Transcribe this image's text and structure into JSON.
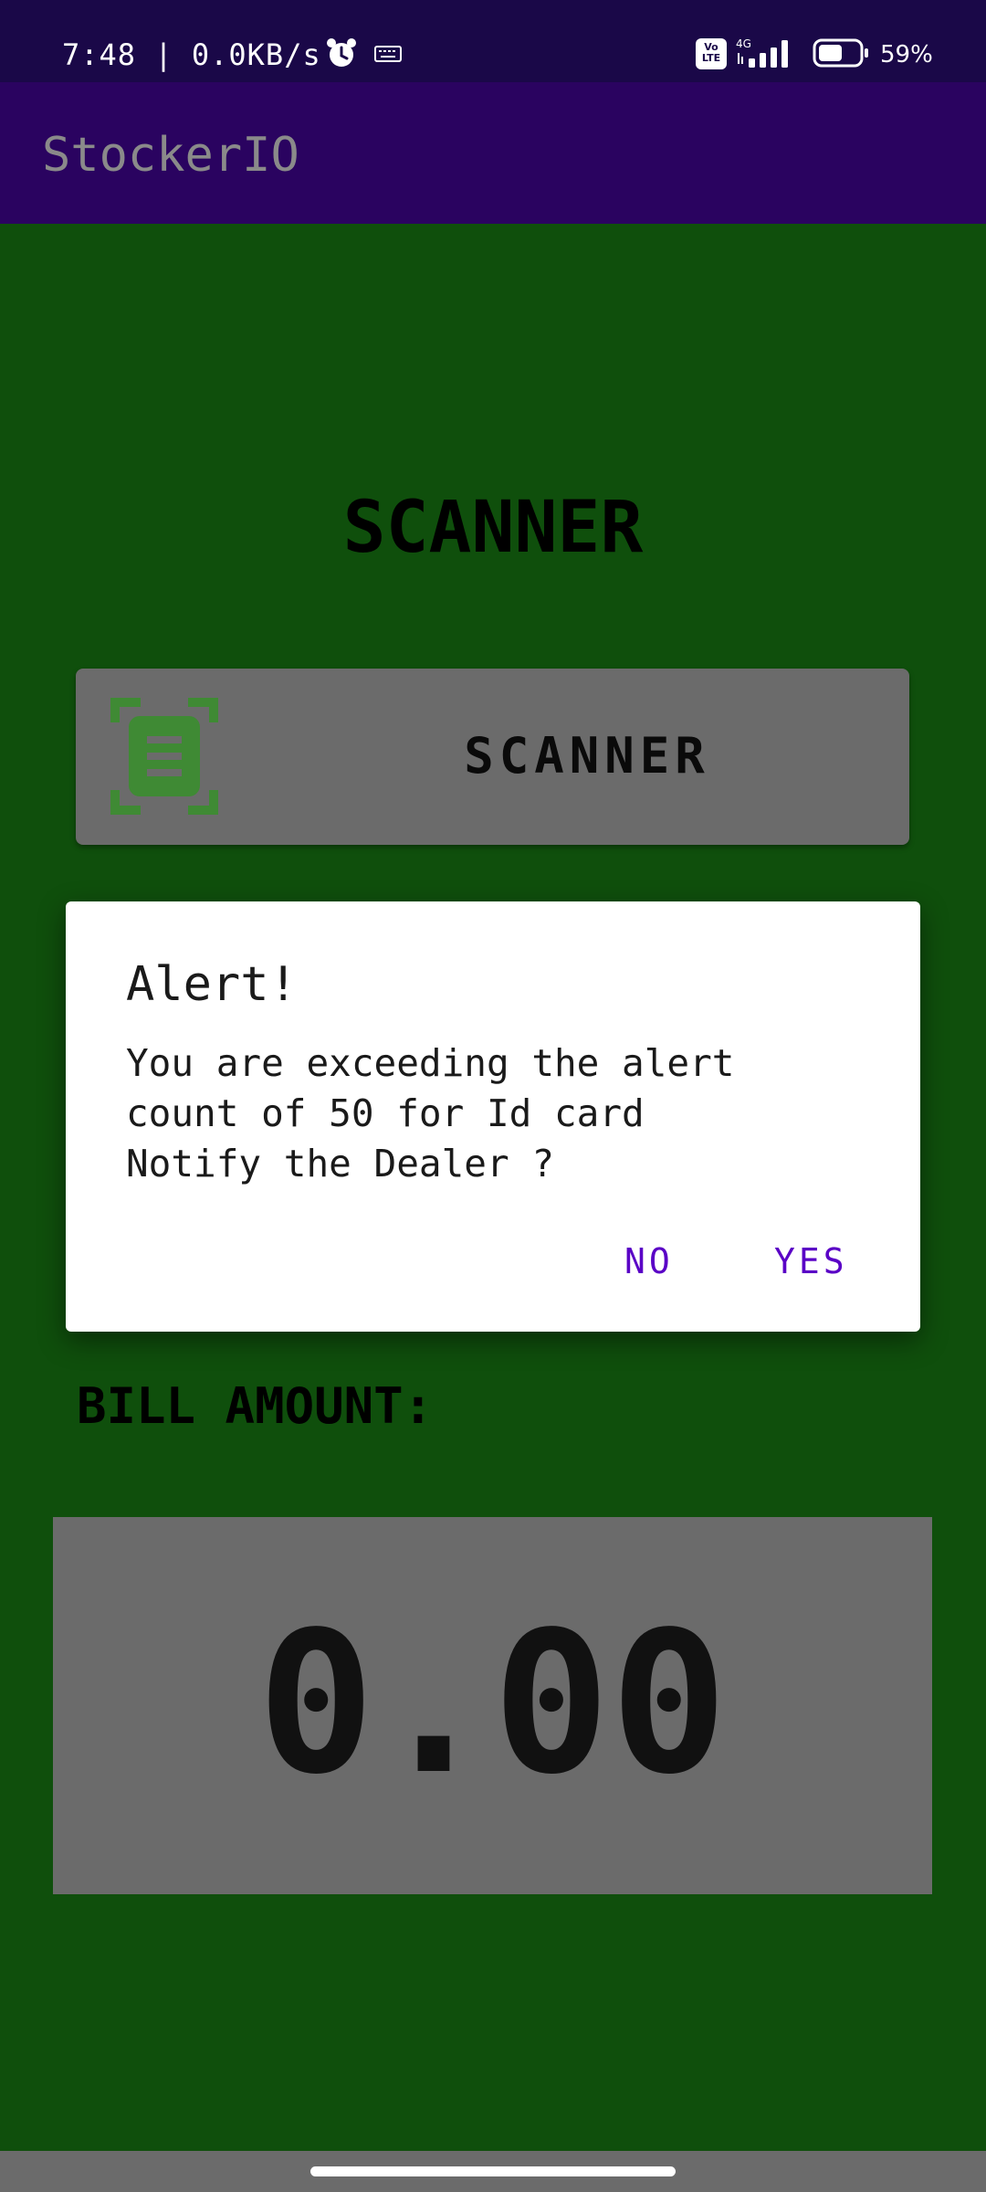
{
  "status_bar": {
    "time": "7:48 | 0.0KB/s",
    "network_type": "4G",
    "volte_label": "Vo\nLTE",
    "battery_percent": "59%",
    "battery_level": 0.59,
    "icons": [
      "alarm-clock-icon",
      "keyboard-icon",
      "volte-icon",
      "signal-icon",
      "battery-icon"
    ]
  },
  "app_bar": {
    "title": "StockerIO"
  },
  "main": {
    "heading": "SCANNER",
    "scanner_button_label": "SCANNER",
    "bill_label": "BILL AMOUNT:",
    "bill_value": "0.00"
  },
  "dialog": {
    "title": "Alert!",
    "message": "You are exceeding the alert\ncount of 50 for Id card\nNotify the Dealer ?",
    "no_label": "NO",
    "yes_label": "YES"
  },
  "colors": {
    "status_bar": "#1a0848",
    "app_bar": "#2a0360",
    "background": "#0f4f0c",
    "panel": "#6b6b6b",
    "dialog_button": "#5a00c6",
    "scanner_icon": "#3f8a34"
  }
}
